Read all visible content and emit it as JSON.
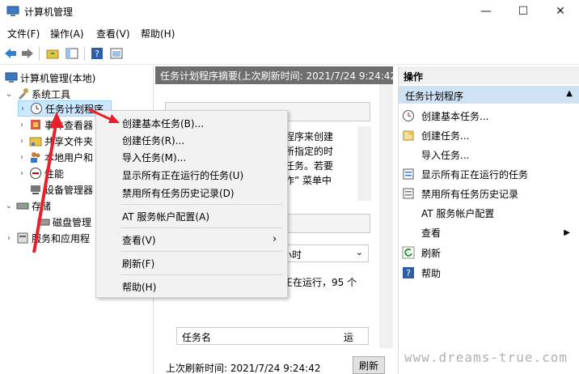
{
  "window": {
    "title": "计算机管理",
    "minimize_glyph": "—",
    "maximize_glyph": "☐",
    "close_glyph": "✕"
  },
  "menu": [
    "文件(F)",
    "操作(A)",
    "查看(V)",
    "帮助(H)"
  ],
  "tree": {
    "root": "计算机管理(本地)",
    "system_tools": "系统工具",
    "task_scheduler": "任务计划程序",
    "event_viewer": "事件查看器",
    "shared_folders": "共享文件夹",
    "local_users": "本地用户和",
    "performance": "性能",
    "device_manager": "设备管理器",
    "storage": "存储",
    "disk_management": "磁盘管理",
    "services_apps": "服务和应用程"
  },
  "center": {
    "header": "任务计划程序摘要(上次刷新时间: 2021/7/24 9:24:42)",
    "text_line1": "程序来创建",
    "text_line2": "所指定的时",
    "text_line3": "任务。若要",
    "text_line4": "作” 菜单中",
    "dropdown_text": "小时",
    "status_text": "正在运行，95 个",
    "col_name": "任务名",
    "col_run": "运",
    "footer_text": "上次刷新时间: 2021/7/24 9:24:42",
    "refresh_button": "刷新"
  },
  "actions": {
    "title": "操作",
    "group": "任务计划程序",
    "items": [
      {
        "label": "创建基本任务...",
        "icon": "create-basic-task-icon"
      },
      {
        "label": "创建任务...",
        "icon": "create-task-icon"
      },
      {
        "label": "导入任务...",
        "icon": ""
      },
      {
        "label": "显示所有正在运行的任务",
        "icon": "running-tasks-icon"
      },
      {
        "label": "禁用所有任务历史记录",
        "icon": "history-icon"
      },
      {
        "label": "AT 服务帐户配置",
        "icon": ""
      },
      {
        "label": "查看",
        "icon": ""
      },
      {
        "label": "刷新",
        "icon": "refresh-icon"
      },
      {
        "label": "帮助",
        "icon": "help-icon"
      }
    ]
  },
  "context_menu": {
    "items": [
      "创建基本任务(B)...",
      "创建任务(R)...",
      "导入任务(M)...",
      "显示所有正在运行的任务(U)",
      "禁用所有任务历史记录(D)",
      "AT 服务帐户配置(A)",
      "查看(V)",
      "刷新(F)",
      "帮助(H)"
    ],
    "submenu_arrow": "›"
  },
  "watermark": "www.dreams-true.com",
  "colors": {
    "accent_arrow": "#e8202a",
    "selection": "#cce8ff",
    "center_header": "#6e6e6e",
    "actions_group": "#cfe2f3"
  }
}
